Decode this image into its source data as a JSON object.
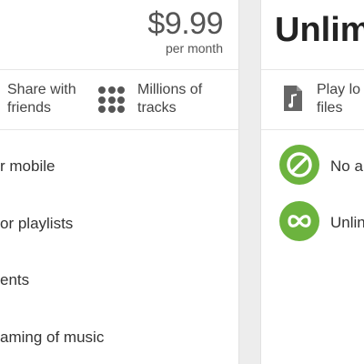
{
  "left_plan": {
    "price": "$9.99",
    "price_period": "per month",
    "features_top": [
      {
        "line1": "Share with",
        "line2": "friends",
        "icon": "share-icon"
      },
      {
        "line1": "Millions of",
        "line2": "tracks",
        "icon": "grid-dots-icon"
      }
    ],
    "features_list": [
      "r mobile",
      "or playlists",
      "ents",
      "aming of music"
    ]
  },
  "right_plan": {
    "title": "Unlim",
    "top_feature": {
      "line1": "Play lo",
      "line2": "files",
      "icon": "music-file-icon"
    },
    "features": [
      {
        "label": "No a",
        "icon": "no-ads-icon"
      },
      {
        "label": "Unlin",
        "icon": "infinity-icon"
      }
    ]
  },
  "colors": {
    "accent_green": "#6cb33e",
    "text": "#333333",
    "background": "#ededed"
  }
}
